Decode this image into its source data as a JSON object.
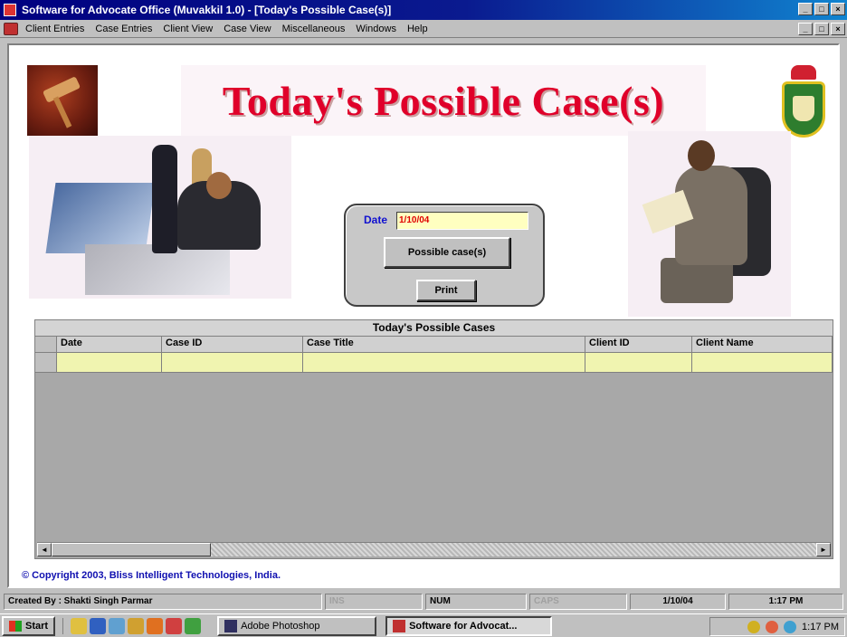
{
  "window": {
    "title": "Software for Advocate Office (Muvakkil 1.0) - [Today's Possible Case(s)]",
    "controls": [
      "_",
      "□",
      "×"
    ]
  },
  "menubar": {
    "items": [
      {
        "label": "Client Entries"
      },
      {
        "label": "Case Entries"
      },
      {
        "label": "Client View"
      },
      {
        "label": "Case View"
      },
      {
        "label": "Miscellaneous"
      },
      {
        "label": "Windows"
      },
      {
        "label": "Help"
      }
    ]
  },
  "form": {
    "heading": "Today's Possible Case(s)",
    "date_label": "Date",
    "date_value": "1/10/04",
    "possible_button": "Possible case(s)",
    "print_button": "Print"
  },
  "grid": {
    "caption": "Today's Possible Cases",
    "columns": [
      "Date",
      "Case ID",
      "Case Title",
      "Client ID",
      "Client Name"
    ],
    "rows": [
      [
        "",
        "",
        "",
        "",
        ""
      ]
    ],
    "scroll_left": "◄",
    "scroll_right": "►"
  },
  "copyright": "© Copyright 2003, Bliss Intelligent Technologies, India.",
  "statusbar": {
    "created_by": "Created By : Shakti Singh Parmar",
    "ins": "INS",
    "num": "NUM",
    "caps": "CAPS",
    "date": "1/10/04",
    "time": "1:17 PM"
  },
  "taskbar": {
    "start": "Start",
    "tasks": [
      {
        "label": "Adobe Photoshop"
      },
      {
        "label": "Software for Advocat..."
      }
    ],
    "clock": "1:17 PM"
  },
  "colors": {
    "title_red": "#e0002a",
    "date_label_blue": "#1010d0",
    "grid_row_yellow": "#f0f4b0",
    "copyright_blue": "#1010b0"
  }
}
